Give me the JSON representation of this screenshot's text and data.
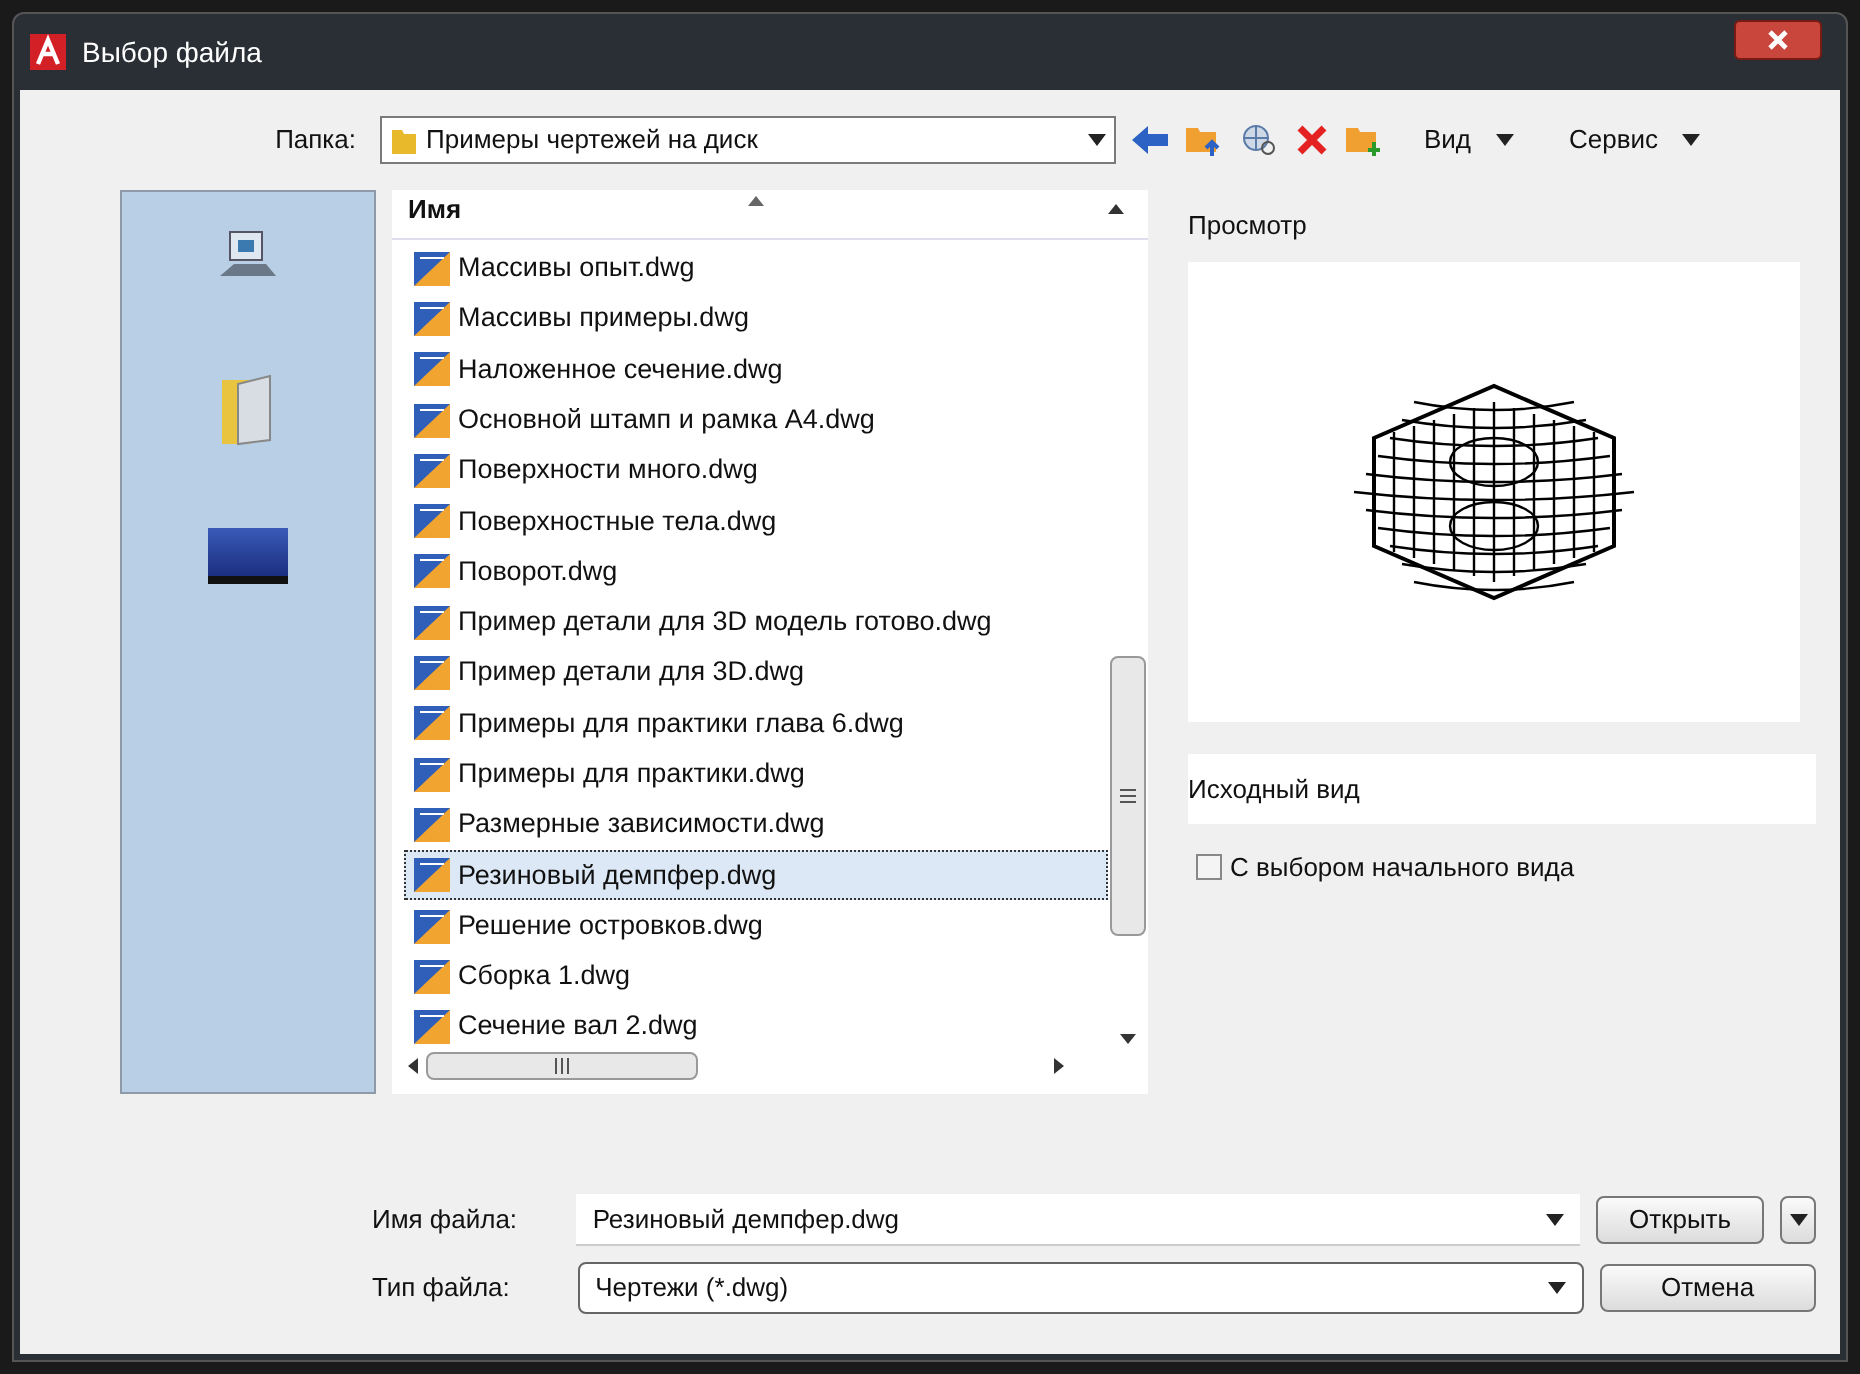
{
  "window": {
    "title": "Выбор файла"
  },
  "folder": {
    "label": "Папка:",
    "value": "Примеры чертежей на диск"
  },
  "toolbar": {
    "menus": [
      "Вид",
      "Сервис"
    ]
  },
  "file_list": {
    "column": "Имя",
    "rows": [
      {
        "name": "Массивы опыт.dwg",
        "selected": false
      },
      {
        "name": "Массивы примеры.dwg",
        "selected": false
      },
      {
        "name": "Наложенное сечение.dwg",
        "selected": false
      },
      {
        "name": "Основной штамп и рамка А4.dwg",
        "selected": false
      },
      {
        "name": "Поверхности много.dwg",
        "selected": false
      },
      {
        "name": "Поверхностные тела.dwg",
        "selected": false
      },
      {
        "name": "Поворот.dwg",
        "selected": false
      },
      {
        "name": "Пример детали для 3D модель готово.dwg",
        "selected": false
      },
      {
        "name": "Пример детали для 3D.dwg",
        "selected": false
      },
      {
        "name": "Примеры для практики глава 6.dwg",
        "selected": false
      },
      {
        "name": "Примеры для практики.dwg",
        "selected": false
      },
      {
        "name": "Размерные зависимости.dwg",
        "selected": false
      },
      {
        "name": "Резиновый демпфер.dwg",
        "selected": true
      },
      {
        "name": "Решение островков.dwg",
        "selected": false
      },
      {
        "name": "Сборка 1.dwg",
        "selected": false
      },
      {
        "name": "Сечение вал 2.dwg",
        "selected": false
      }
    ]
  },
  "preview": {
    "label": "Просмотр",
    "initial_view": "Исходный вид",
    "checkbox": {
      "label": "С выбором начального вида",
      "checked": false
    }
  },
  "file_name": {
    "label": "Имя файла:",
    "value": "Резиновый демпфер.dwg",
    "button": "Открыть"
  },
  "file_type": {
    "label": "Тип файла:",
    "value": "Чертежи (*.dwg)",
    "button": "Отмена"
  }
}
